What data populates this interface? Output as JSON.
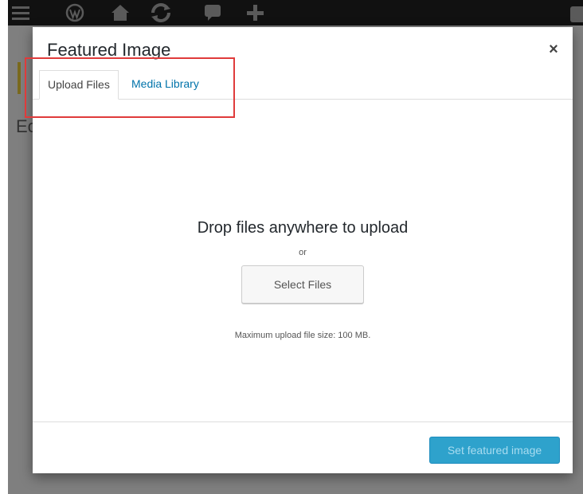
{
  "modal": {
    "title": "Featured Image",
    "close_symbol": "×",
    "tabs": [
      {
        "label": "Upload Files",
        "active": true
      },
      {
        "label": "Media Library",
        "active": false
      }
    ],
    "upload": {
      "drop_text": "Drop files anywhere to upload",
      "or_text": "or",
      "select_button": "Select Files",
      "max_size_text": "Maximum upload file size: 100 MB."
    },
    "toolbar": {
      "primary_button": "Set featured image",
      "primary_disabled": true
    }
  },
  "background": {
    "heading_fragment": "Ec",
    "admin_bar_icons": [
      "menu-icon",
      "wordpress-logo-icon",
      "home-icon",
      "updates-icon",
      "comments-icon",
      "new-content-icon"
    ]
  },
  "colors": {
    "accent": "#0073aa",
    "primary_button": "#2ea2cc",
    "highlight": "#e03b3b"
  }
}
